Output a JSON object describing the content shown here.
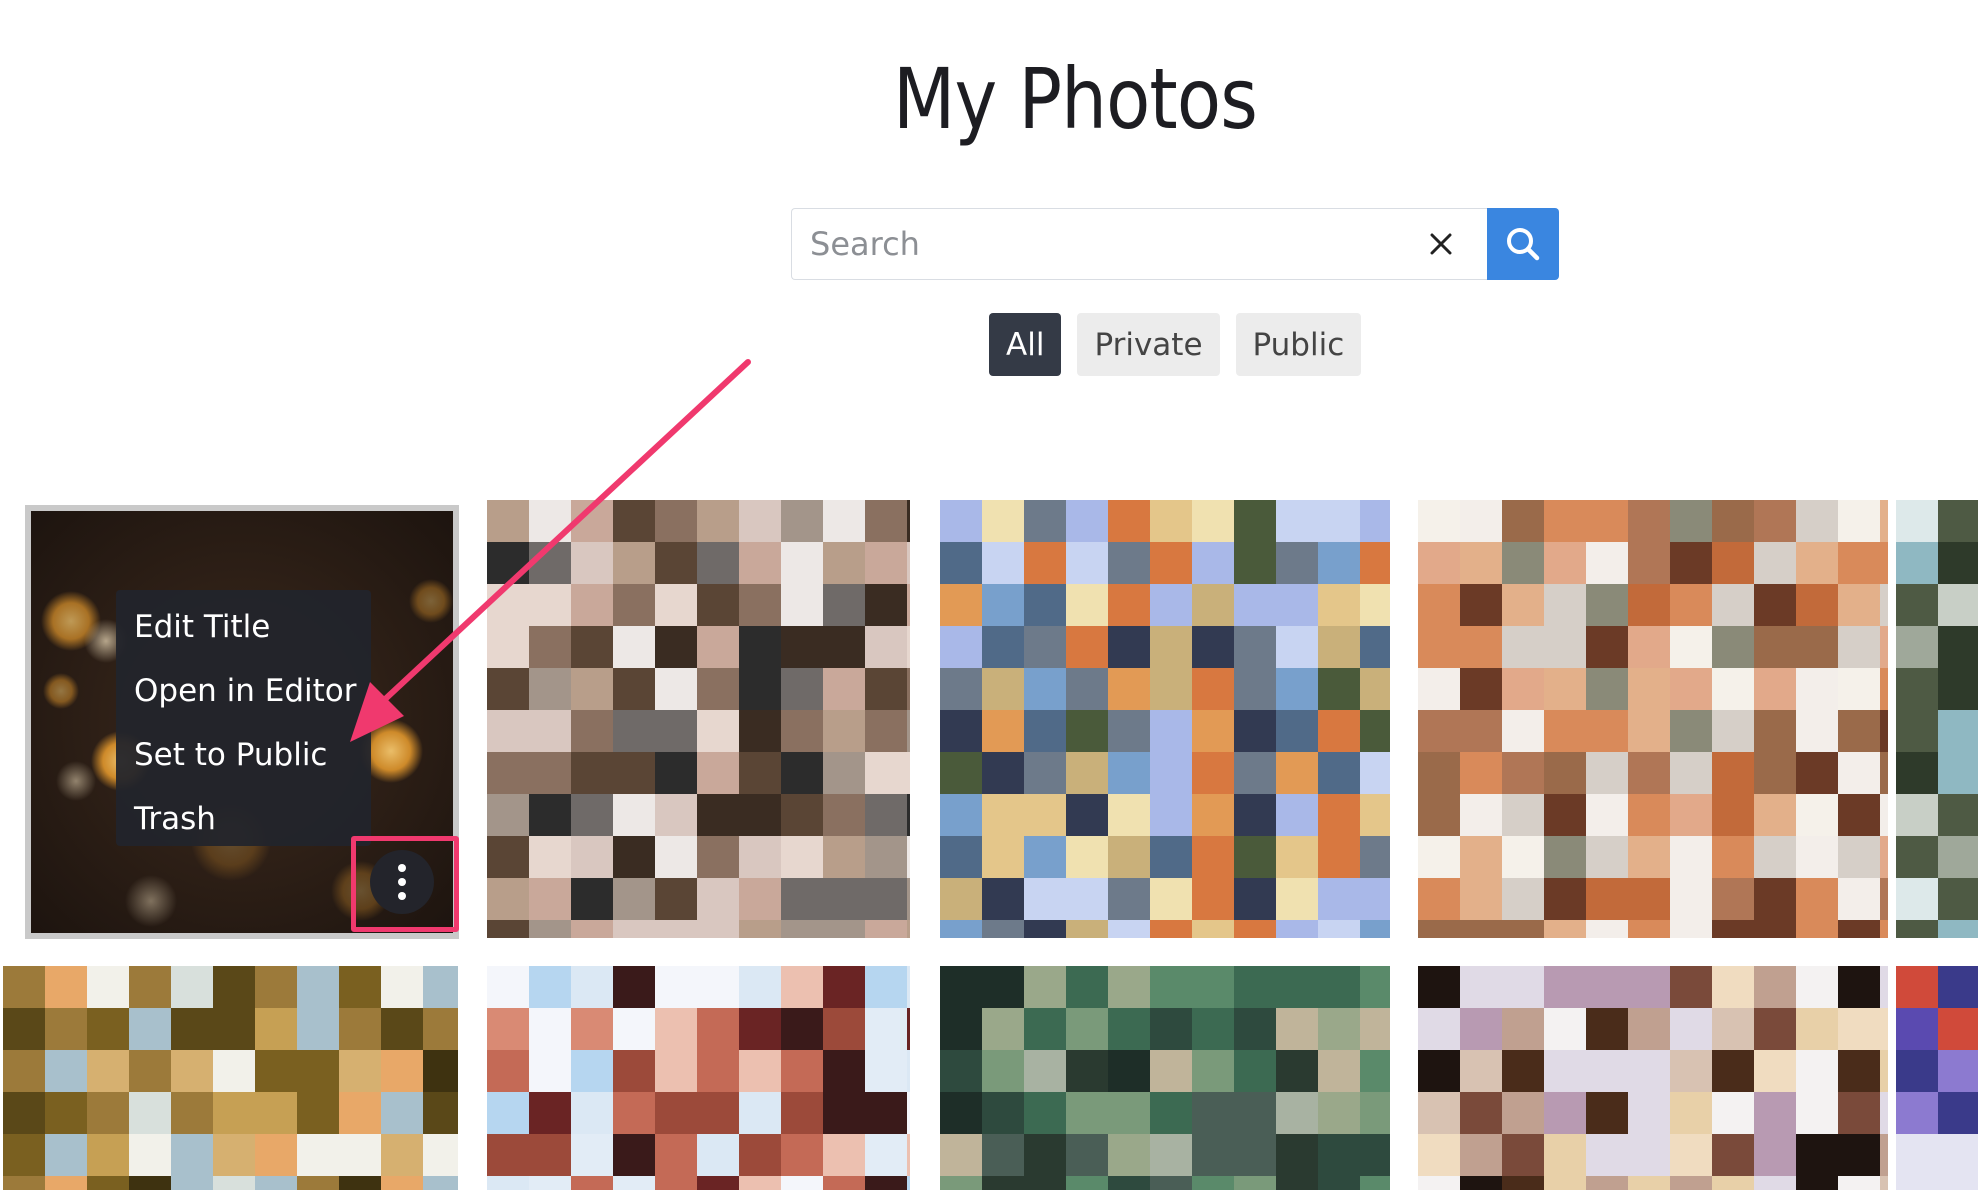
{
  "page": {
    "title": "My Photos"
  },
  "search": {
    "placeholder": "Search",
    "value": ""
  },
  "filters": [
    {
      "label": "All",
      "active": true
    },
    {
      "label": "Private",
      "active": false
    },
    {
      "label": "Public",
      "active": false
    }
  ],
  "context_menu": {
    "items": [
      {
        "label": "Edit Title"
      },
      {
        "label": "Open in Editor"
      },
      {
        "label": "Set to Public"
      },
      {
        "label": "Trash"
      }
    ]
  },
  "icons": {
    "clear": "close-icon",
    "search": "search-icon",
    "more": "kebab-icon"
  },
  "colors": {
    "accent": "#3a86e0",
    "active_filter": "#343a46",
    "annotation": "#f0396e"
  }
}
